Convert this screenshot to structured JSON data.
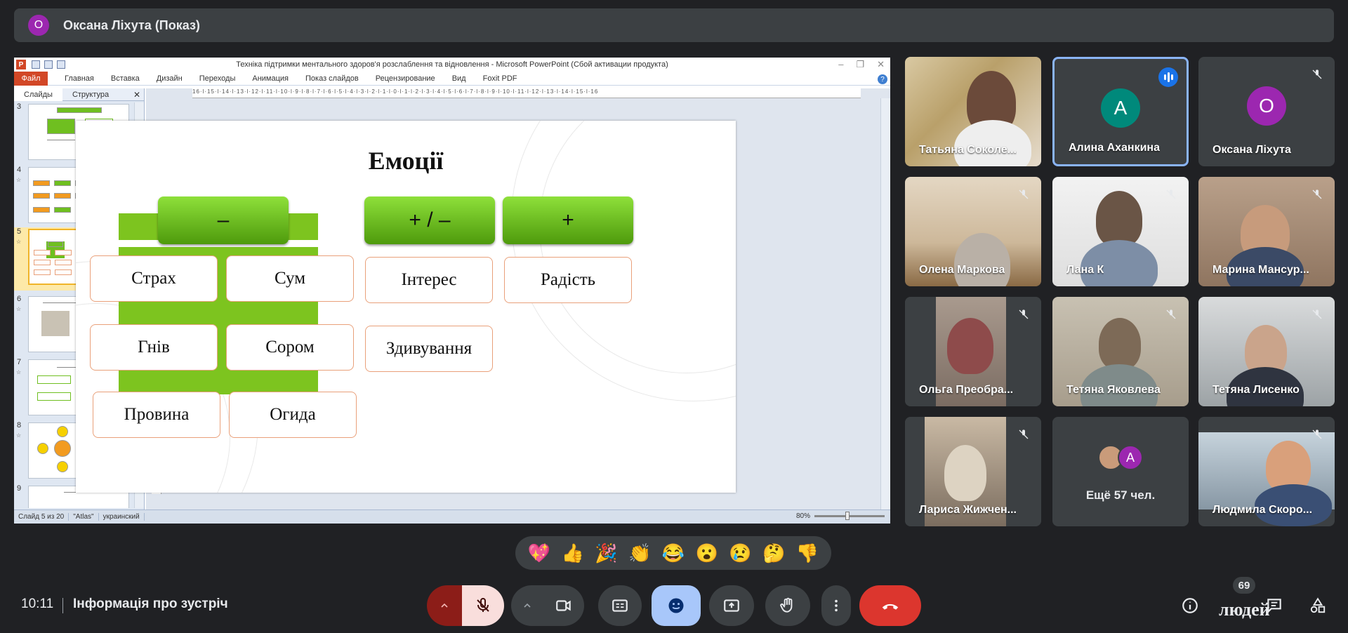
{
  "presenter": {
    "avatar_letter": "О",
    "name": "Оксана Ліхута (Показ)",
    "avatar_color": "#9c27b0"
  },
  "powerpoint": {
    "window_title": "Техніка підтримки ментального  здоров'я розслаблення та відновлення  -  Microsoft PowerPoint (Сбой активации продукта)",
    "file_tab": "Файл",
    "tabs": [
      "Главная",
      "Вставка",
      "Дизайн",
      "Переходы",
      "Анимация",
      "Показ слайдов",
      "Рецензирование",
      "Вид",
      "Foxit PDF"
    ],
    "panel_tabs": [
      "Слайды",
      "Структура"
    ],
    "thumbnails": [
      "3",
      "4",
      "5",
      "6",
      "7",
      "8",
      "9"
    ],
    "selected_thumbnail": "5",
    "ruler_text": "16·l·15·l·14·l·13·l·12·l·11·l·10·l·9·l·8·l·7·l·6·l·5·l·4·l·3·l·2·l·1·l·0·l·1·l·2·l·3·l·4·l·5·l·6·l·7·l·8·l·9·l·10·l·11·l·12·l·13·l·14·l·15·l·16",
    "slide": {
      "title": "Емоції",
      "headers": [
        "–",
        "+ / –",
        "+"
      ],
      "negative": [
        "Страх",
        "Сум",
        "Гнів",
        "Сором",
        "Провина",
        "Огида"
      ],
      "mixed": [
        "Інтерес",
        "Здивування"
      ],
      "positive": [
        "Радість"
      ]
    },
    "status": {
      "slide_info": "Слайд 5 из 20",
      "theme": "\"Atlas\"",
      "language": "украинский",
      "zoom": "80%"
    }
  },
  "tiles": [
    {
      "name": "Татьяна Соколе...",
      "type": "video",
      "muted": false,
      "speaking": false
    },
    {
      "name": "Алина Аханкина",
      "type": "avatar",
      "letter": "A",
      "color": "#00897b",
      "speaking": true,
      "active": true
    },
    {
      "name": "Оксана Ліхута",
      "type": "avatar",
      "letter": "О",
      "color": "#9c27b0",
      "muted": true
    },
    {
      "name": "Олена Маркова",
      "type": "video",
      "muted": true
    },
    {
      "name": "Лана К",
      "type": "video",
      "muted": true
    },
    {
      "name": "Марина Мансур...",
      "type": "video",
      "muted": true
    },
    {
      "name": "Ольга Преобра...",
      "type": "video",
      "muted": true
    },
    {
      "name": "Тетяна Яковлева",
      "type": "video",
      "muted": true
    },
    {
      "name": "Тетяна Лисенко",
      "type": "video",
      "muted": true
    },
    {
      "name": "Лариса Жижчен...",
      "type": "video",
      "muted": true
    },
    {
      "name": "Ещё 57 чел.",
      "type": "more",
      "avatar_letter": "A",
      "avatar_color": "#9c27b0"
    },
    {
      "name": "Людмила Скоро...",
      "type": "video",
      "muted": true
    }
  ],
  "reactions": [
    "💖",
    "👍",
    "🎉",
    "👏",
    "😂",
    "😮",
    "😢",
    "🤔",
    "👎"
  ],
  "bottom_bar": {
    "time": "10:11",
    "meeting_info": "Інформація про зустріч",
    "participants_count": "69",
    "people_label": "людей"
  }
}
